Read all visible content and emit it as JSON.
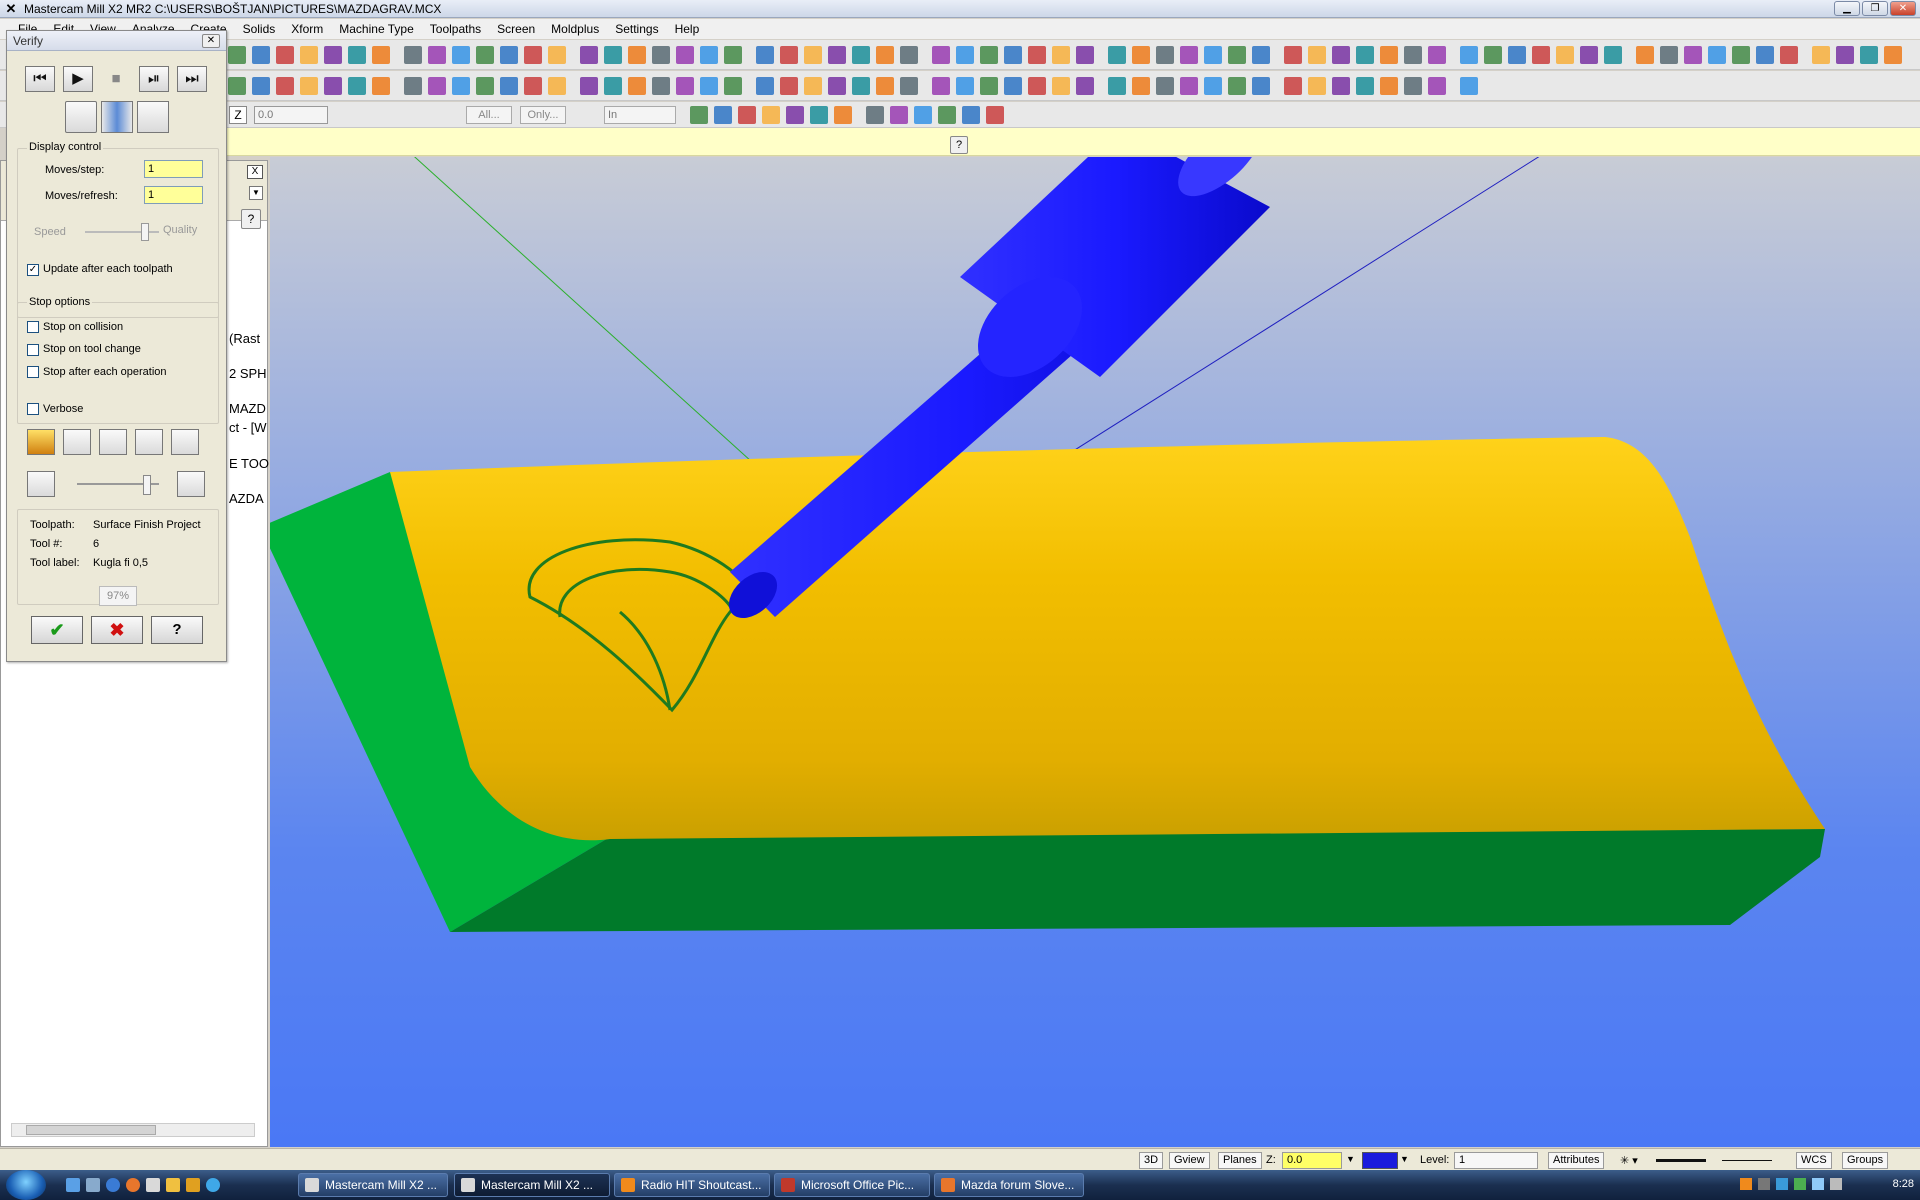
{
  "window": {
    "title": "Mastercam Mill X2 MR2  C:\\USERS\\BOŠTJAN\\PICTURES\\MAZDAGRAV.MCX",
    "app_icon": "mastercam-icon"
  },
  "menu": [
    "File",
    "Edit",
    "View",
    "Analyze",
    "Create",
    "Solids",
    "Xform",
    "Machine Type",
    "Toolpaths",
    "Screen",
    "Moldplus",
    "Settings",
    "Help"
  ],
  "toolbar3": {
    "z_label": "Z",
    "z_value": "0.0",
    "all_label": "All...",
    "only_label": "Only...",
    "units_value": "In"
  },
  "opmgr": {
    "close_label": "X",
    "fragments": [
      "(Rast",
      "2 SPH",
      "MAZD",
      "ct - [W",
      "E TOO",
      "AZDA"
    ]
  },
  "verify": {
    "title": "Verify",
    "display_control": "Display control",
    "moves_step_label": "Moves/step:",
    "moves_step_value": "1",
    "moves_refresh_label": "Moves/refresh:",
    "moves_refresh_value": "1",
    "speed_label": "Speed",
    "quality_label": "Quality",
    "update_label": "Update after each toolpath",
    "update_checked": true,
    "stop_options": "Stop options",
    "stop_collision": "Stop on collision",
    "stop_tool_change": "Stop on tool change",
    "stop_each_op": "Stop after each operation",
    "verbose": "Verbose",
    "toolpath_label": "Toolpath:",
    "toolpath_value": "Surface Finish Project",
    "toolnum_label": "Tool #:",
    "toolnum_value": "6",
    "toollabel_label": "Tool label:",
    "toollabel_value": "Kugla fi 0,5",
    "progress": "97%"
  },
  "statusbar": {
    "mode_3d": "3D",
    "gview": "Gview",
    "planes": "Planes",
    "z_label": "Z:",
    "z_value": "0.0",
    "level_label": "Level:",
    "level_value": "1",
    "attributes": "Attributes",
    "wcs": "WCS",
    "groups": "Groups"
  },
  "taskbar": {
    "tasks": [
      {
        "label": "Mastercam Mill X2 ...",
        "color": "#d9d9d9",
        "active": false
      },
      {
        "label": "Mastercam Mill X2 ...",
        "color": "#d9d9d9",
        "active": true
      },
      {
        "label": "Radio HIT Shoutcast...",
        "color": "#f08a1c",
        "active": false
      },
      {
        "label": "Microsoft Office Pic...",
        "color": "#c0392b",
        "active": false
      },
      {
        "label": "Mazda forum Slove...",
        "color": "#e8762c",
        "active": false
      }
    ],
    "clock": "8:28"
  },
  "colors": {
    "stock_yellow": "#e6b800",
    "stock_green": "#00b43c",
    "tool_blue": "#1a1aff",
    "toolpath_green": "#1f7a1f"
  }
}
